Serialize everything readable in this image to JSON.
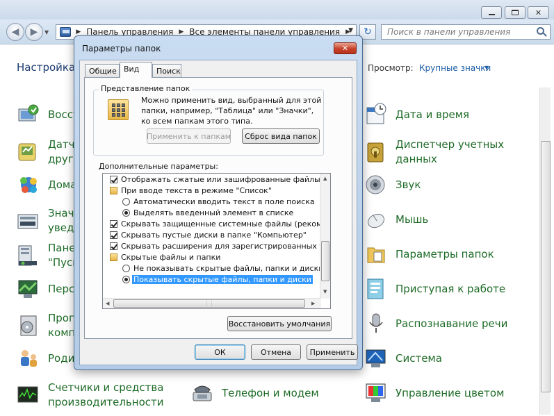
{
  "control_panel": {
    "address": [
      "Панель управления",
      "Все элементы панели управления"
    ],
    "search_placeholder": "Поиск в панели управления",
    "header_title": "Настройка (",
    "view_label": "Просмотр:",
    "view_value": "Крупные значки",
    "items_left": [
      {
        "label1": "Восст",
        "label2": "",
        "icon": "backup-icon"
      },
      {
        "label1": "Датч",
        "label2": "други",
        "icon": "sensor-icon"
      },
      {
        "label1": "Дома",
        "label2": "",
        "icon": "homegroup-icon"
      },
      {
        "label1": "Значі",
        "label2": "уведо",
        "icon": "tray-icons-icon"
      },
      {
        "label1": "Пане",
        "label2": "\"Пуск",
        "icon": "taskbar-icon"
      },
      {
        "label1": "Персо",
        "label2": "",
        "icon": "personalization-icon"
      },
      {
        "label1": "Прогр",
        "label2": "комп",
        "icon": "programs-icon"
      },
      {
        "label1": "Роди",
        "label2": "",
        "icon": "parental-icon"
      },
      {
        "label1": "Счетчики и средства",
        "label2": "производительности",
        "icon": "performance-icon"
      }
    ],
    "items_right": [
      {
        "label1": "Дата и время",
        "label2": "",
        "icon": "calendar-icon"
      },
      {
        "label1": "Диспетчер учетных",
        "label2": "данных",
        "icon": "credential-icon"
      },
      {
        "label1": "Звук",
        "label2": "",
        "icon": "speaker-icon"
      },
      {
        "label1": "Мышь",
        "label2": "",
        "icon": "mouse-icon"
      },
      {
        "label1": "Параметры папок",
        "label2": "",
        "icon": "folder-options-icon"
      },
      {
        "label1": "Приступая к работе",
        "label2": "",
        "icon": "getting-started-icon"
      },
      {
        "label1": "Распознавание речи",
        "label2": "",
        "icon": "microphone-icon"
      },
      {
        "label1": "Система",
        "label2": "",
        "icon": "system-icon"
      },
      {
        "label1": "Управление цветом",
        "label2": "",
        "icon": "color-management-icon"
      }
    ],
    "item_middle": {
      "label1": "Телефон и модем",
      "icon": "phone-modem-icon"
    }
  },
  "dialog": {
    "title": "Параметры папок",
    "close_glyph": "✕",
    "tabs": [
      "Общие",
      "Вид",
      "Поиск"
    ],
    "active_tab": "Вид",
    "folder_view_group": "Представление папок",
    "folder_view_desc": "Можно применить вид, выбранный для этой папки, например, \"Таблица\" или \"Значки\", ко всем папкам этого типа.",
    "apply_to_folders": "Применить к папкам",
    "reset_folders": "Сброс вида папок",
    "advanced_label": "Дополнительные параметры:",
    "tree": [
      {
        "type": "checkbox",
        "checked": true,
        "indent": 0,
        "text": "Отображать сжатые или зашифрованные файлы NTFS"
      },
      {
        "type": "folder",
        "indent": 0,
        "text": "При вводе текста в режиме \"Список\""
      },
      {
        "type": "radio",
        "checked": false,
        "indent": 1,
        "text": "Автоматически вводить текст в поле поиска"
      },
      {
        "type": "radio",
        "checked": true,
        "indent": 1,
        "text": "Выделять введенный элемент в списке"
      },
      {
        "type": "checkbox",
        "checked": true,
        "indent": 0,
        "text": "Скрывать защищенные системные файлы (рекомендуется)"
      },
      {
        "type": "checkbox",
        "checked": true,
        "indent": 0,
        "text": "Скрывать пустые диски в папке \"Компьютер\""
      },
      {
        "type": "checkbox",
        "checked": true,
        "indent": 0,
        "text": "Скрывать расширения для зарегистрированных типов файлов"
      },
      {
        "type": "folder",
        "indent": 0,
        "text": "Скрытые файлы и папки"
      },
      {
        "type": "radio",
        "checked": false,
        "indent": 1,
        "text": "Не показывать скрытые файлы, папки и диски"
      },
      {
        "type": "radio",
        "checked": true,
        "selected": true,
        "indent": 1,
        "text": "Показывать скрытые файлы, папки и диски"
      }
    ],
    "restore_defaults": "Восстановить умолчания",
    "ok": "ОК",
    "cancel": "Отмена",
    "apply": "Применить"
  }
}
